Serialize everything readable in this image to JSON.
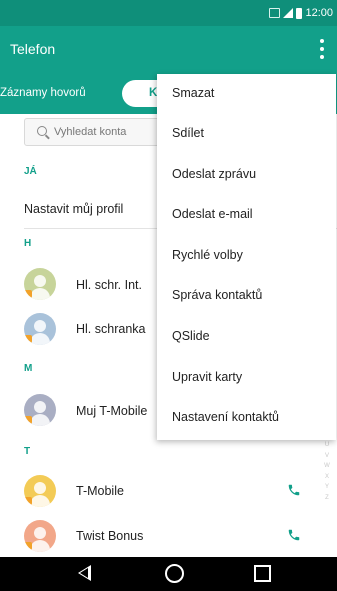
{
  "status_bar": {
    "time": "12:00"
  },
  "app_bar": {
    "title": "Telefon"
  },
  "tabs": {
    "calls_label": "Záznamy hovorů",
    "contacts_label": "K"
  },
  "search": {
    "placeholder": "Vyhledat konta"
  },
  "sections": {
    "me": "JÁ",
    "h": "H",
    "m": "M",
    "t": "T"
  },
  "profile": {
    "label": "Nastavit můj profil"
  },
  "contacts": [
    {
      "name": "Hl. schr. Int.",
      "avatar_color": "#c7d49a"
    },
    {
      "name": "Hl. schranka",
      "avatar_color": "#a9c2da"
    },
    {
      "name": "Muj T-Mobile",
      "avatar_color": "#a9aec3"
    },
    {
      "name": "T-Mobile",
      "avatar_color": "#f3cb56"
    },
    {
      "name": "Twist Bonus",
      "avatar_color": "#f2a789"
    }
  ],
  "index_letters": [
    "U",
    "V",
    "W",
    "X",
    "Y",
    "Z"
  ],
  "menu": {
    "items": [
      "Smazat",
      "Sdílet",
      "Odeslat zprávu",
      "Odeslat e-mail",
      "Rychlé volby",
      "Správa kontaktů",
      "QSlide",
      "Upravit karty",
      "Nastavení kontaktů"
    ]
  },
  "colors": {
    "accent": "#12a08a",
    "status_bar": "#0f8f7a",
    "call_icon": "#12a08a"
  },
  "icons": {
    "overflow": "overflow-menu-icon",
    "search": "search-icon",
    "call": "phone-icon",
    "back": "back-icon",
    "home": "home-icon",
    "recents": "recents-icon"
  }
}
